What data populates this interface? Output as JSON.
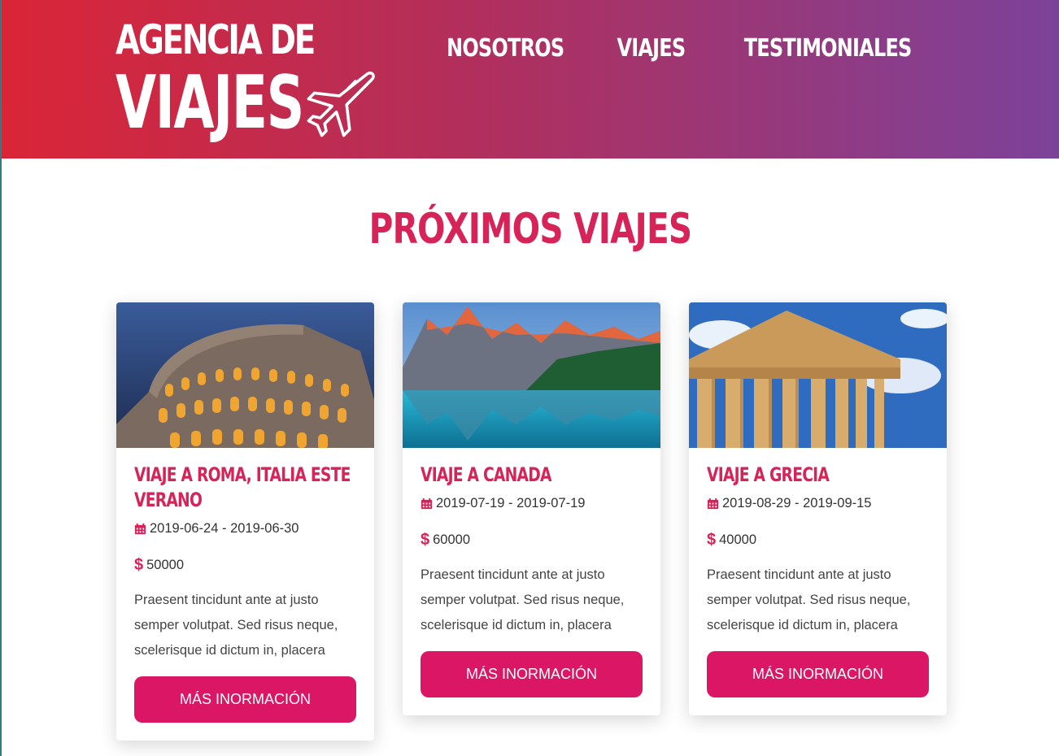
{
  "header": {
    "logo_line1": "AGENCIA DE",
    "logo_line2": "VIAJES",
    "nav": [
      {
        "label": "NOSOTROS"
      },
      {
        "label": "VIAJES"
      },
      {
        "label": "TESTIMONIALES"
      }
    ]
  },
  "main": {
    "section_title": "PRÓXIMOS VIAJES",
    "trips": [
      {
        "title": "VIAJE A ROMA, ITALIA ESTE VERANO",
        "dates": "2019-06-24 - 2019-06-30",
        "price": "50000",
        "description": "Praesent tincidunt ante at justo semper volutpat. Sed risus neque, scelerisque id dictum in, placera",
        "button_label": "MÁS INORMACIÓN",
        "image": "colosseum-photo"
      },
      {
        "title": "VIAJE A CANADA",
        "dates": "2019-07-19 - 2019-07-19",
        "price": "60000",
        "description": "Praesent tincidunt ante at justo semper volutpat. Sed risus neque, scelerisque id dictum in, placera",
        "button_label": "MÁS INORMACIÓN",
        "image": "lake-mountains-photo"
      },
      {
        "title": "VIAJE A GRECIA",
        "dates": "2019-08-29 - 2019-09-15",
        "price": "40000",
        "description": "Praesent tincidunt ante at justo semper volutpat. Sed risus neque, scelerisque id dictum in, placera",
        "button_label": "MÁS INORMACIÓN",
        "image": "parthenon-photo"
      }
    ]
  },
  "icons": {
    "dollar": "$",
    "calendar": "calendar-icon",
    "plane": "plane-icon"
  },
  "colors": {
    "accent": "#d62459",
    "button": "#db1765",
    "header_gradient_start": "#da2537",
    "header_gradient_end": "#7c429a"
  }
}
